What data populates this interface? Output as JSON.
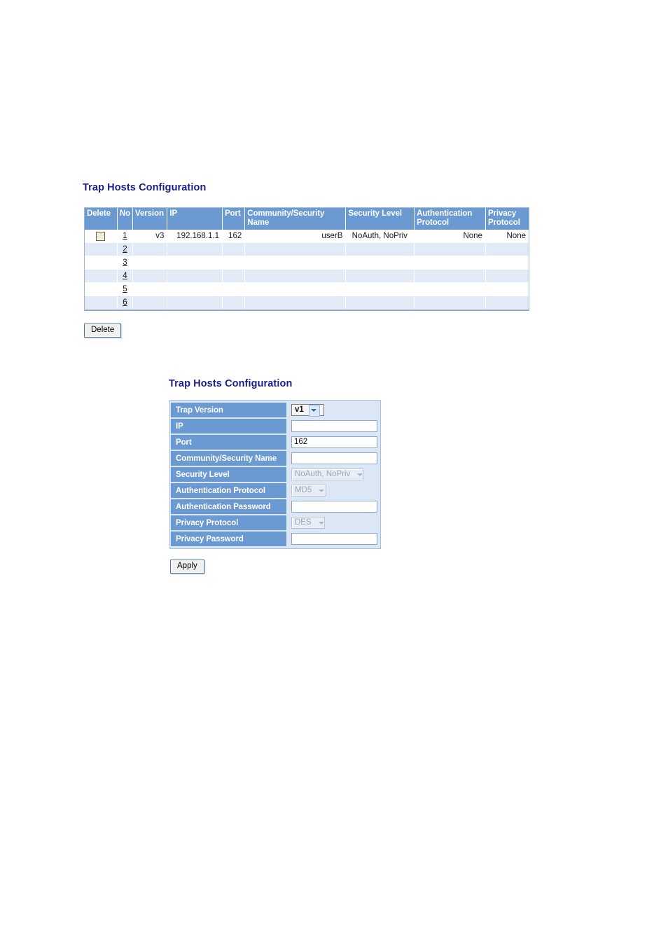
{
  "list_section": {
    "title": "Trap Hosts Configuration",
    "table": {
      "headers": [
        "Delete",
        "No",
        "Version",
        "IP",
        "Port",
        "Community/Security Name",
        "Security Level",
        "Authentication Protocol",
        "Privacy Protocol"
      ],
      "rows": [
        {
          "no": "1",
          "checked": false,
          "version": "v3",
          "ip": "192.168.1.1",
          "port": "162",
          "community": "userB",
          "security_level": "NoAuth, NoPriv",
          "auth_protocol": "None",
          "privacy_protocol": "None"
        },
        {
          "no": "2",
          "checked": false,
          "version": "",
          "ip": "",
          "port": "",
          "community": "",
          "security_level": "",
          "auth_protocol": "",
          "privacy_protocol": ""
        },
        {
          "no": "3",
          "checked": false,
          "version": "",
          "ip": "",
          "port": "",
          "community": "",
          "security_level": "",
          "auth_protocol": "",
          "privacy_protocol": ""
        },
        {
          "no": "4",
          "checked": false,
          "version": "",
          "ip": "",
          "port": "",
          "community": "",
          "security_level": "",
          "auth_protocol": "",
          "privacy_protocol": ""
        },
        {
          "no": "5",
          "checked": false,
          "version": "",
          "ip": "",
          "port": "",
          "community": "",
          "security_level": "",
          "auth_protocol": "",
          "privacy_protocol": ""
        },
        {
          "no": "6",
          "checked": false,
          "version": "",
          "ip": "",
          "port": "",
          "community": "",
          "security_level": "",
          "auth_protocol": "",
          "privacy_protocol": ""
        }
      ]
    },
    "delete_button_label": "Delete"
  },
  "form_section": {
    "title": "Trap Hosts Configuration",
    "fields": {
      "trap_version": {
        "label": "Trap Version",
        "value": "v1",
        "control": "select",
        "enabled": true
      },
      "ip": {
        "label": "IP",
        "value": "",
        "control": "text",
        "enabled": true
      },
      "port": {
        "label": "Port",
        "value": "162",
        "control": "text",
        "enabled": true
      },
      "community_security_name": {
        "label": "Community/Security Name",
        "value": "",
        "control": "text",
        "enabled": true
      },
      "security_level": {
        "label": "Security Level",
        "value": "NoAuth, NoPriv",
        "control": "select",
        "enabled": false
      },
      "authentication_protocol": {
        "label": "Authentication Protocol",
        "value": "MD5",
        "control": "select",
        "enabled": false
      },
      "authentication_password": {
        "label": "Authentication Password",
        "value": "",
        "control": "text",
        "enabled": true
      },
      "privacy_protocol": {
        "label": "Privacy Protocol",
        "value": "DES",
        "control": "select",
        "enabled": false
      },
      "privacy_password": {
        "label": "Privacy Password",
        "value": "",
        "control": "text",
        "enabled": true
      }
    },
    "apply_button_label": "Apply"
  },
  "colors": {
    "header_blue": "#6b99d1",
    "title_navy": "#1c1c8c",
    "row_alt": "#e3eaf7",
    "form_field_bg": "#dce7f6"
  }
}
